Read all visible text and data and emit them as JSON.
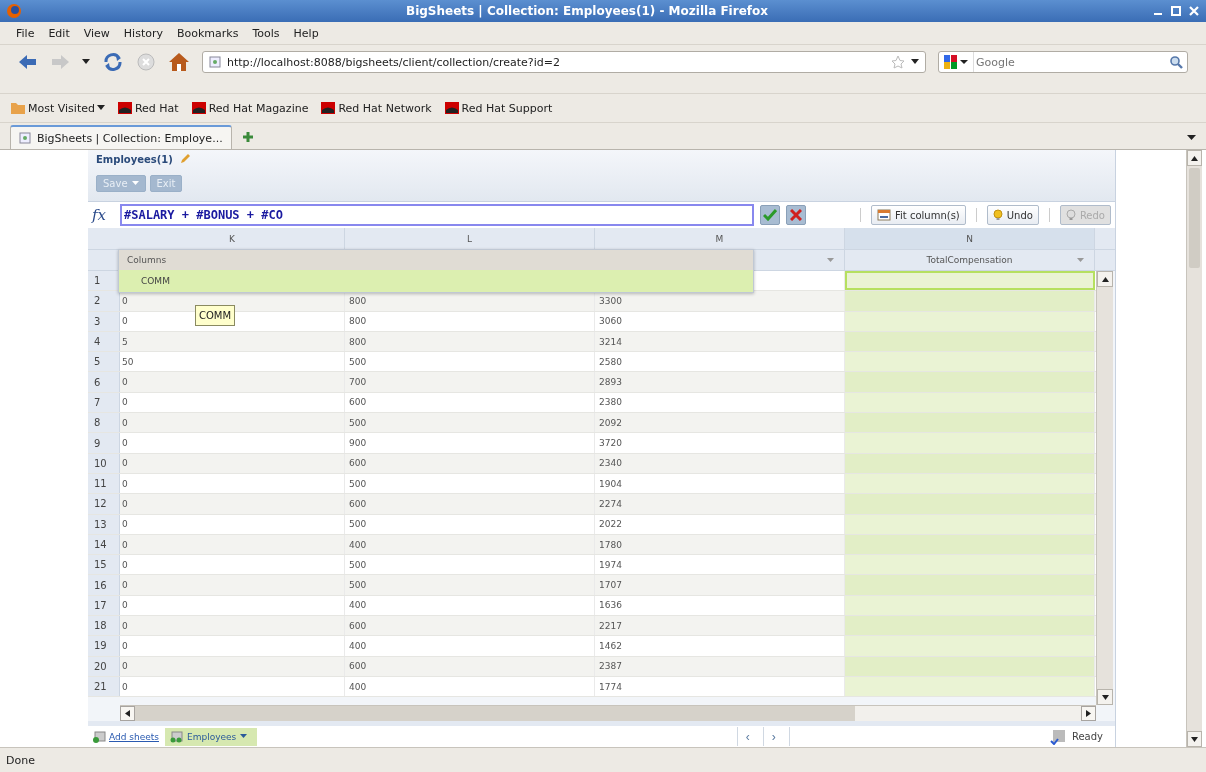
{
  "window": {
    "title": "BigSheets | Collection: Employees(1) - Mozilla Firefox"
  },
  "menu": [
    {
      "label": "File"
    },
    {
      "label": "Edit"
    },
    {
      "label": "View"
    },
    {
      "label": "History"
    },
    {
      "label": "Bookmarks"
    },
    {
      "label": "Tools"
    },
    {
      "label": "Help"
    }
  ],
  "navigation": {
    "url": "http://localhost:8088/bigsheets/client/collection/create?id=2",
    "search_placeholder": "Google"
  },
  "bookmarks": [
    {
      "label": "Most Visited",
      "kind": "folder"
    },
    {
      "label": "Red Hat",
      "kind": "link"
    },
    {
      "label": "Red Hat Magazine",
      "kind": "link"
    },
    {
      "label": "Red Hat Network",
      "kind": "link"
    },
    {
      "label": "Red Hat Support",
      "kind": "link"
    }
  ],
  "tabs": [
    {
      "label": "BigSheets | Collection: Employe...",
      "selected": true
    }
  ],
  "app": {
    "title": "Employees(1)",
    "buttons": [
      {
        "label": "Save",
        "kind": "menu",
        "disabled": true
      },
      {
        "label": "Exit",
        "kind": "plain",
        "disabled": true
      }
    ]
  },
  "formula": {
    "label": "fx",
    "value": "#SALARY + #BONUS + #CO",
    "actions": [
      {
        "label": "Fit column(s)",
        "kind": "fit",
        "disabled": false
      },
      {
        "label": "Undo",
        "kind": "undo",
        "disabled": false
      },
      {
        "label": "Redo",
        "kind": "redo",
        "disabled": true
      }
    ]
  },
  "grid": {
    "columns": [
      {
        "letter": "K",
        "selected": false
      },
      {
        "letter": "L",
        "selected": false
      },
      {
        "letter": "M",
        "selected": false
      },
      {
        "letter": "N",
        "selected": true,
        "header": "TotalCompensation"
      }
    ],
    "rows": [
      {
        "number": "1",
        "current": true,
        "cells": []
      },
      {
        "number": "2",
        "current": false,
        "cells": [
          "0",
          "800",
          "3300"
        ]
      },
      {
        "number": "3",
        "current": false,
        "cells": [
          "0",
          "800",
          "3060"
        ]
      },
      {
        "number": "4",
        "current": false,
        "cells": [
          "5",
          "800",
          "3214"
        ]
      },
      {
        "number": "5",
        "current": false,
        "cells": [
          "50",
          "500",
          "2580"
        ]
      },
      {
        "number": "6",
        "current": false,
        "cells": [
          "0",
          "700",
          "2893"
        ]
      },
      {
        "number": "7",
        "current": false,
        "cells": [
          "0",
          "600",
          "2380"
        ]
      },
      {
        "number": "8",
        "current": false,
        "cells": [
          "0",
          "500",
          "2092"
        ]
      },
      {
        "number": "9",
        "current": false,
        "cells": [
          "0",
          "900",
          "3720"
        ]
      },
      {
        "number": "10",
        "current": false,
        "cells": [
          "0",
          "600",
          "2340"
        ]
      },
      {
        "number": "11",
        "current": false,
        "cells": [
          "0",
          "500",
          "1904"
        ]
      },
      {
        "number": "12",
        "current": false,
        "cells": [
          "0",
          "600",
          "2274"
        ]
      },
      {
        "number": "13",
        "current": false,
        "cells": [
          "0",
          "500",
          "2022"
        ]
      },
      {
        "number": "14",
        "current": false,
        "cells": [
          "0",
          "400",
          "1780"
        ]
      },
      {
        "number": "15",
        "current": false,
        "cells": [
          "0",
          "500",
          "1974"
        ]
      },
      {
        "number": "16",
        "current": false,
        "cells": [
          "0",
          "500",
          "1707"
        ]
      },
      {
        "number": "17",
        "current": false,
        "cells": [
          "0",
          "400",
          "1636"
        ]
      },
      {
        "number": "18",
        "current": false,
        "cells": [
          "0",
          "600",
          "2217"
        ]
      },
      {
        "number": "19",
        "current": false,
        "cells": [
          "0",
          "400",
          "1462"
        ]
      },
      {
        "number": "20",
        "current": false,
        "cells": [
          "0",
          "600",
          "2387"
        ]
      },
      {
        "number": "21",
        "current": false,
        "cells": [
          "0",
          "400",
          "1774"
        ]
      }
    ]
  },
  "autocomplete": {
    "heading": "Columns",
    "items": [
      {
        "label": "COMM",
        "selected": true
      }
    ]
  },
  "tooltip": "COMM",
  "sheets": {
    "add_label": "Add sheets",
    "tabs": [
      {
        "label": "Employees",
        "selected": true
      }
    ],
    "nav": [
      "‹",
      "›"
    ],
    "status": "Ready"
  },
  "status_bar": "Done"
}
